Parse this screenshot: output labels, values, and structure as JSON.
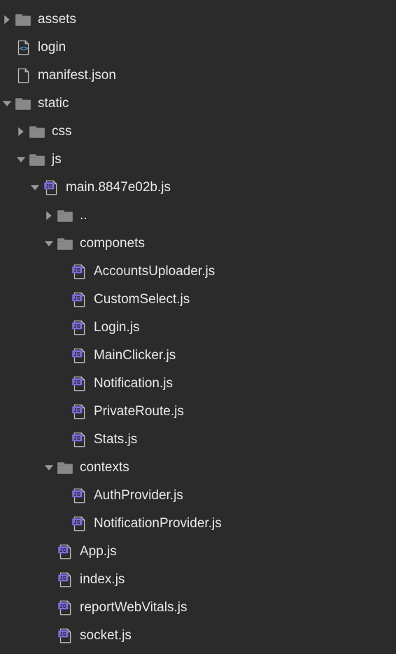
{
  "tree": [
    {
      "depth": 0,
      "expanded": false,
      "icon": "folder",
      "label": "assets"
    },
    {
      "depth": 0,
      "expanded": null,
      "icon": "html",
      "label": "login"
    },
    {
      "depth": 0,
      "expanded": null,
      "icon": "file",
      "label": "manifest.json"
    },
    {
      "depth": 0,
      "expanded": true,
      "icon": "folder",
      "label": "static"
    },
    {
      "depth": 1,
      "expanded": false,
      "icon": "folder",
      "label": "css"
    },
    {
      "depth": 1,
      "expanded": true,
      "icon": "folder",
      "label": "js"
    },
    {
      "depth": 2,
      "expanded": true,
      "icon": "js",
      "label": "main.8847e02b.js"
    },
    {
      "depth": 3,
      "expanded": false,
      "icon": "folder",
      "label": ".."
    },
    {
      "depth": 3,
      "expanded": true,
      "icon": "folder",
      "label": "componets"
    },
    {
      "depth": 4,
      "expanded": null,
      "icon": "js",
      "label": "AccountsUploader.js"
    },
    {
      "depth": 4,
      "expanded": null,
      "icon": "js",
      "label": "CustomSelect.js"
    },
    {
      "depth": 4,
      "expanded": null,
      "icon": "js",
      "label": "Login.js"
    },
    {
      "depth": 4,
      "expanded": null,
      "icon": "js",
      "label": "MainClicker.js"
    },
    {
      "depth": 4,
      "expanded": null,
      "icon": "js",
      "label": "Notification.js"
    },
    {
      "depth": 4,
      "expanded": null,
      "icon": "js",
      "label": "PrivateRoute.js"
    },
    {
      "depth": 4,
      "expanded": null,
      "icon": "js",
      "label": "Stats.js"
    },
    {
      "depth": 3,
      "expanded": true,
      "icon": "folder",
      "label": "contexts"
    },
    {
      "depth": 4,
      "expanded": null,
      "icon": "js",
      "label": "AuthProvider.js"
    },
    {
      "depth": 4,
      "expanded": null,
      "icon": "js",
      "label": "NotificationProvider.js"
    },
    {
      "depth": 3,
      "expanded": null,
      "icon": "js",
      "label": "App.js"
    },
    {
      "depth": 3,
      "expanded": null,
      "icon": "js",
      "label": "index.js"
    },
    {
      "depth": 3,
      "expanded": null,
      "icon": "js",
      "label": "reportWebVitals.js"
    },
    {
      "depth": 3,
      "expanded": null,
      "icon": "js",
      "label": "socket.js"
    }
  ]
}
